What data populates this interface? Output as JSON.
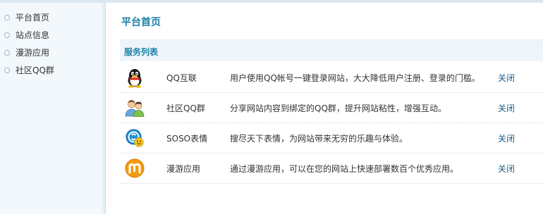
{
  "sidebar": {
    "items": [
      {
        "label": "平台首页"
      },
      {
        "label": "站点信息"
      },
      {
        "label": "漫游应用"
      },
      {
        "label": "社区QQ群"
      }
    ]
  },
  "main": {
    "page_title": "平台首页",
    "section_title": "服务列表",
    "services": [
      {
        "icon": "qq-penguin-icon",
        "name": "QQ互联",
        "description": "用户使用QQ帐号一键登录网站，大大降低用户注册、登录的门槛。",
        "action": "关闭"
      },
      {
        "icon": "community-group-icon",
        "name": "社区QQ群",
        "description": "分享网站内容到绑定的QQ群，提升网站粘性，增强互动。",
        "action": "关闭"
      },
      {
        "icon": "soso-emoticon-icon",
        "name": "SOSO表情",
        "description": "搜尽天下表情，为网站带来无穷的乐趣与体验。",
        "action": "关闭"
      },
      {
        "icon": "manyou-m-icon",
        "name": "漫游应用",
        "description": "通过漫游应用，可以在您的网站上快速部署数百个优秀应用。",
        "action": "关闭"
      }
    ]
  },
  "colors": {
    "accent": "#1d82a8",
    "sidebar_bg": "#f2f8fb",
    "section_bg": "#eef6fb",
    "link": "#1d5f86"
  }
}
